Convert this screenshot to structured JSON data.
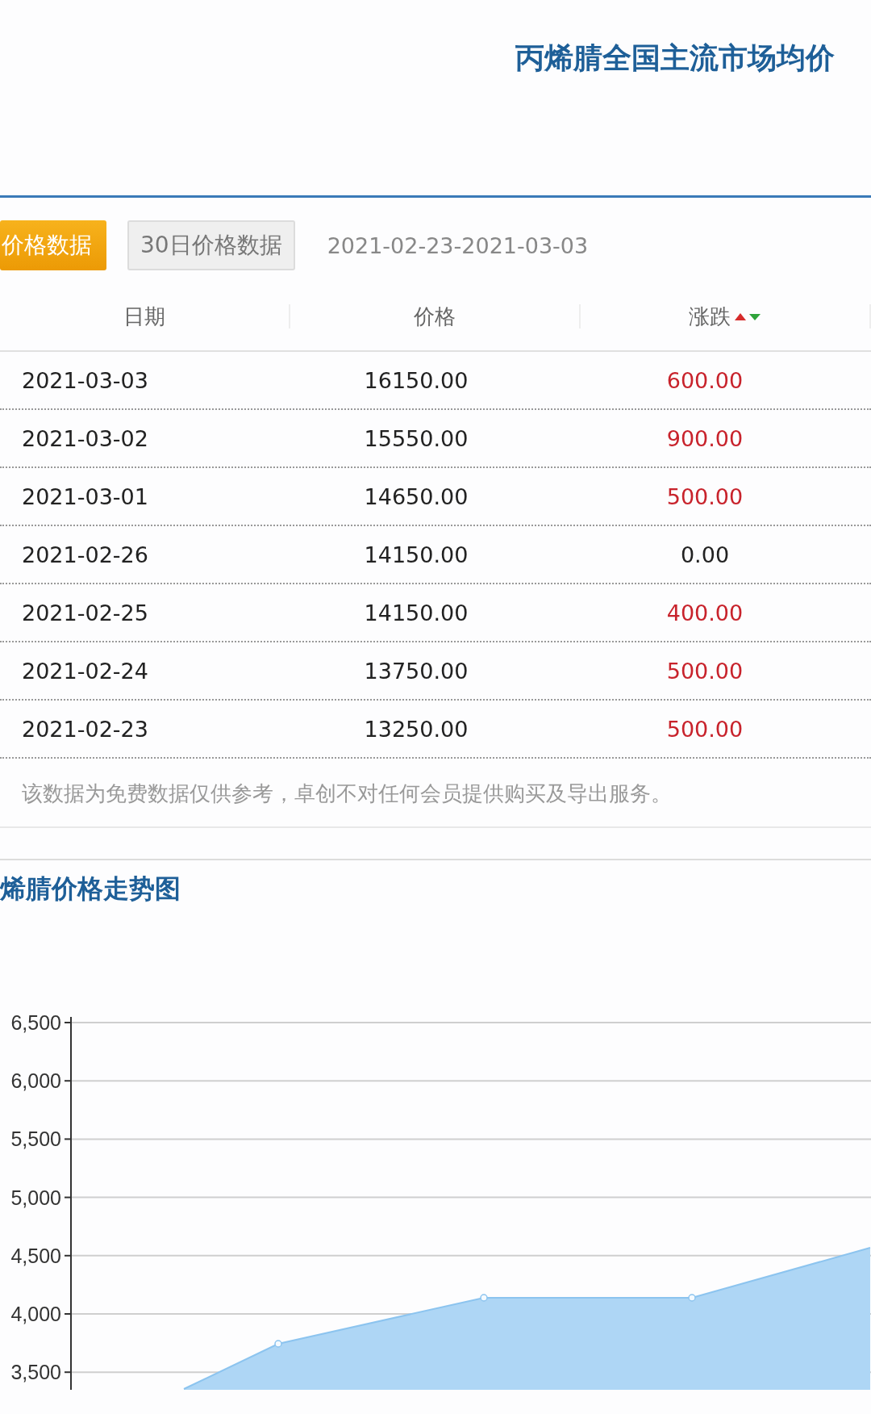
{
  "heading": "丙烯腈全国主流市场均价",
  "tabs": [
    {
      "label": "价格数据",
      "selected": true
    },
    {
      "label": "30日价格数据",
      "selected": false
    }
  ],
  "date_range": "2021-02-23-2021-03-03",
  "table": {
    "columns": [
      {
        "label": "日期",
        "sortable": false
      },
      {
        "label": "价格",
        "sortable": false
      },
      {
        "label": "涨跌",
        "sortable": true
      }
    ],
    "rows": [
      {
        "date": "2021-03-03",
        "price": "16150.00",
        "change": "600.00",
        "color": "#c8232c"
      },
      {
        "date": "2021-03-02",
        "price": "15550.00",
        "change": "900.00",
        "color": "#c8232c"
      },
      {
        "date": "2021-03-01",
        "price": "14650.00",
        "change": "500.00",
        "color": "#c8232c"
      },
      {
        "date": "2021-02-26",
        "price": "14150.00",
        "change": "0.00",
        "color": "#222222"
      },
      {
        "date": "2021-02-25",
        "price": "14150.00",
        "change": "400.00",
        "color": "#c8232c"
      },
      {
        "date": "2021-02-24",
        "price": "13750.00",
        "change": "500.00",
        "color": "#c8232c"
      },
      {
        "date": "2021-02-23",
        "price": "13250.00",
        "change": "500.00",
        "color": "#c8232c"
      }
    ]
  },
  "note": "该数据为免费数据仅供参考，卓创不对任何会员提供购买及导出服务。",
  "chart_section": {
    "title": "烯腈价格走势图",
    "axis_labels": [
      "6,500",
      "6,000",
      "5,500",
      "5,000",
      "4,500",
      "4,000",
      "3,500"
    ]
  }
}
